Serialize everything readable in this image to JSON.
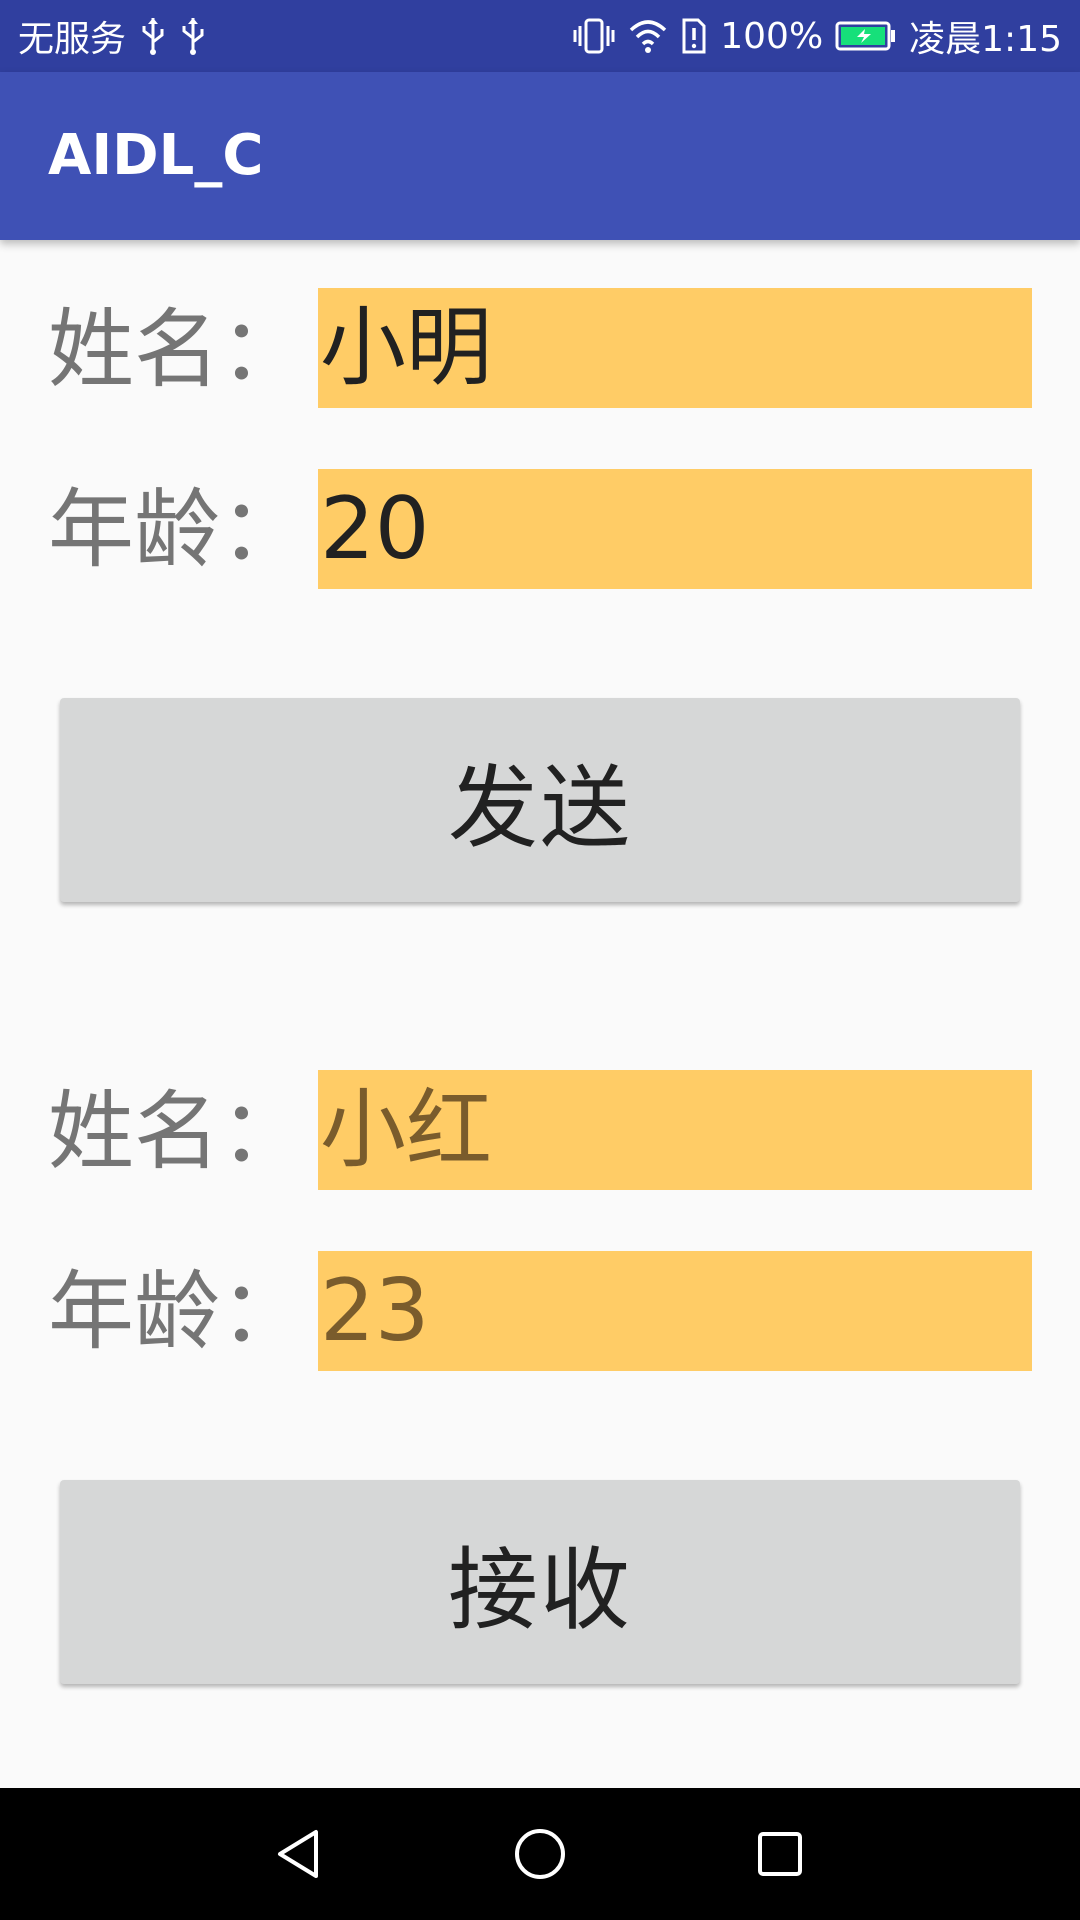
{
  "status_bar": {
    "carrier": "无服务",
    "battery_percent": "100%",
    "time": "凌晨1:15",
    "icons": [
      "usb-icon",
      "usb-icon",
      "vibrate-icon",
      "wifi-icon",
      "alert-icon",
      "battery-charging-icon"
    ],
    "battery_color": "#16e07a"
  },
  "app_bar": {
    "title": "AIDL_C",
    "color": "#3f51b5"
  },
  "send_section": {
    "name_label": "姓名：",
    "name_value": "小明",
    "age_label": "年龄：",
    "age_value": "20",
    "button_label": "发送"
  },
  "receive_section": {
    "name_label": "姓名：",
    "name_value": "小红",
    "age_label": "年龄：",
    "age_value": "23",
    "button_label": "接收"
  },
  "nav_bar": {
    "icons": [
      "back-icon",
      "home-icon",
      "recents-icon"
    ]
  }
}
